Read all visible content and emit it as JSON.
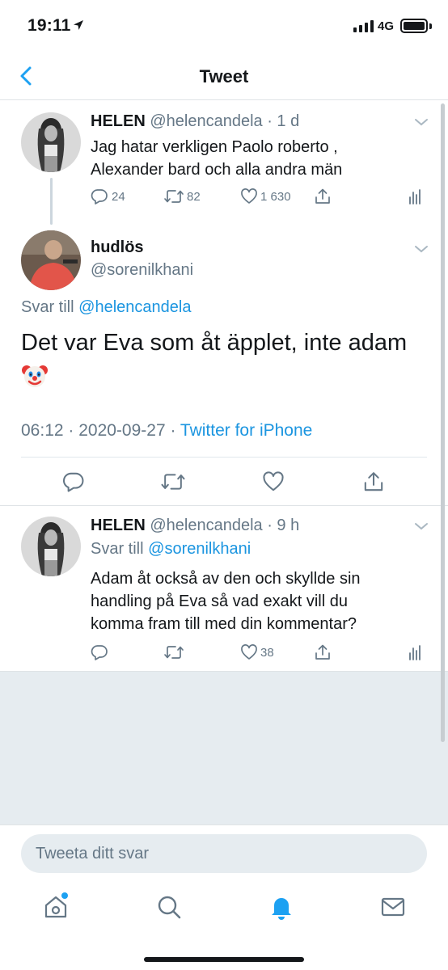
{
  "status_bar": {
    "time": "19:11",
    "network": "4G"
  },
  "header": {
    "title": "Tweet"
  },
  "tweets": [
    {
      "name": "HELEN",
      "handle": "@helencandela",
      "time": "· 1 d",
      "lines": [
        "Jag hatar verkligen Paolo roberto ,",
        "Alexander bard och alla andra män"
      ],
      "replies": "24",
      "retweets": "82",
      "likes": "1 630"
    },
    {
      "name": "hudlös",
      "handle": "@sorenilkhani",
      "reply_prefix": "Svar till",
      "reply_to": "@helencandela",
      "text": "Det var Eva som åt äpplet, inte adam",
      "emoji": "🤡",
      "timestamp": "06:12 · 2020-09-27 · ",
      "source": "Twitter for iPhone"
    },
    {
      "name": "HELEN",
      "handle": "@helencandela",
      "time": "· 9 h",
      "reply_prefix": "Svar till",
      "reply_to": "@sorenilkhani",
      "lines": [
        "Adam åt också av den och skyllde sin",
        "handling på Eva så vad exakt vill du",
        "komma fram till med din kommentar?"
      ],
      "likes": "38"
    }
  ],
  "compose": {
    "placeholder": "Tweeta ditt svar"
  },
  "colors": {
    "accent": "#1da1f2",
    "link": "#1b95e0",
    "muted": "#657786"
  },
  "tabs": [
    "home-icon",
    "search-icon",
    "notifications-icon",
    "messages-icon"
  ]
}
